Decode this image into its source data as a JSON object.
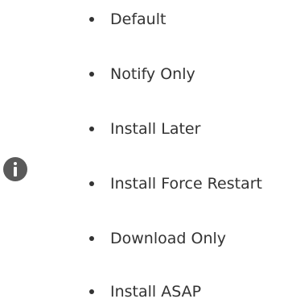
{
  "callout": {
    "icon": "info-icon",
    "icon_color": "#5a5a5a"
  },
  "options": [
    {
      "label": "Default"
    },
    {
      "label": "Notify Only"
    },
    {
      "label": "Install Later"
    },
    {
      "label": "Install Force Restart"
    },
    {
      "label": "Download Only"
    },
    {
      "label": "Install ASAP"
    }
  ]
}
